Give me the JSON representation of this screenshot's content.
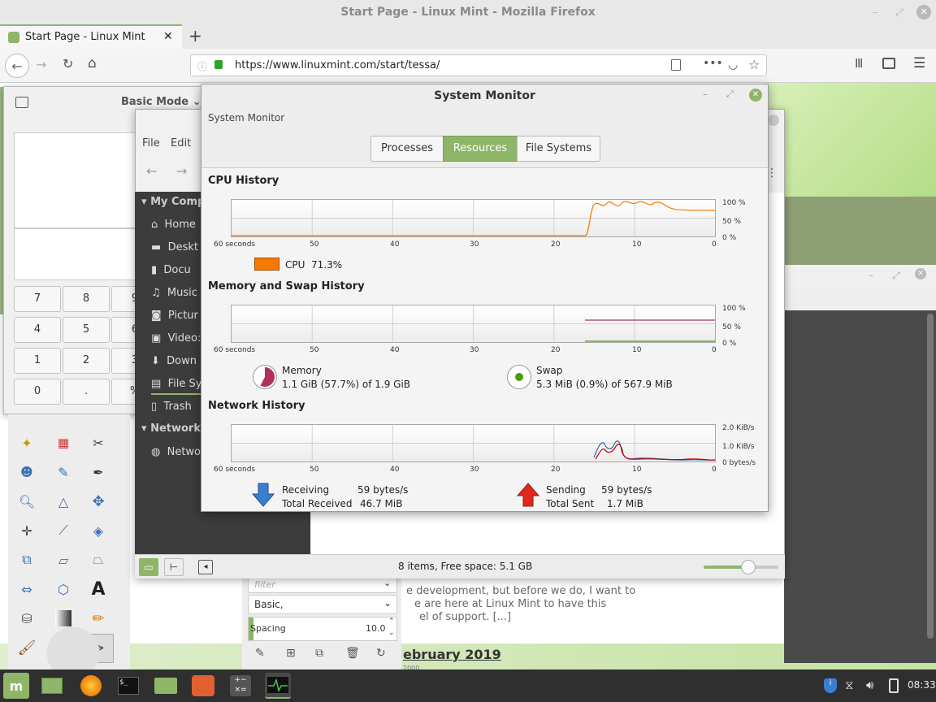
{
  "firefox": {
    "window_title": "Start Page - Linux Mint - Mozilla Firefox",
    "tab_title": "Start Page - Linux Mint",
    "url": "https://www.linuxmint.com/start/tessa/",
    "page_text": {
      "line1": "e development, but before we do, I want to",
      "line2": "e are here at Linux Mint to have this",
      "line3": "el of support. [...]",
      "heading": "ebruary 2019",
      "sub": "2000"
    }
  },
  "calculator": {
    "mode": "Basic Mode",
    "keys": [
      "7",
      "8",
      "9",
      "4",
      "5",
      "6",
      "1",
      "2",
      "3",
      "0",
      ".",
      "%"
    ]
  },
  "file_manager": {
    "menu": [
      "File",
      "Edit"
    ],
    "sections": {
      "my_computer": "My Comp",
      "network": "Network"
    },
    "items": [
      "Home",
      "Deskt",
      "Docu",
      "Music",
      "Pictur",
      "Video:",
      "Down",
      "File Sy",
      "Trash"
    ],
    "network_items": [
      "Netwo"
    ],
    "status": "8 items, Free space: 5.1 GB",
    "zoom": 0.6
  },
  "gimp_dock": {
    "filter_placeholder": "filter",
    "preset": "Basic,",
    "spacing_label": "Spacing",
    "spacing_value": "10.0"
  },
  "system_monitor": {
    "title": "System Monitor",
    "header_label": "System Monitor",
    "tabs": [
      "Processes",
      "Resources",
      "File Systems"
    ],
    "active_tab": "Resources",
    "cpu": {
      "section": "CPU History",
      "legend": "CPU",
      "value": "71.3%",
      "color": "#f57900",
      "y_ticks": [
        "100 %",
        "50 %",
        "0 %"
      ]
    },
    "memory": {
      "section": "Memory and Swap History",
      "mem_label": "Memory",
      "mem_value": "1.1 GiB (57.7%) of 1.9 GiB",
      "mem_color": "#b0305e",
      "swap_label": "Swap",
      "swap_value": "5.3 MiB (0.9%) of 567.9 MiB",
      "swap_color": "#4e9a06",
      "y_ticks": [
        "100 %",
        "50 %",
        "0 %"
      ]
    },
    "network": {
      "section": "Network History",
      "recv_label": "Receiving",
      "recv_rate": "59 bytes/s",
      "recv_total_label": "Total Received",
      "recv_total": "46.7 MiB",
      "send_label": "Sending",
      "send_rate": "59 bytes/s",
      "send_total_label": "Total Sent",
      "send_total": "1.7 MiB",
      "y_ticks": [
        "2.0 KiB/s",
        "1.0 KiB/s",
        "0 bytes/s"
      ]
    },
    "x_ticks": [
      "60 seconds",
      "50",
      "40",
      "30",
      "20",
      "10",
      "0"
    ]
  },
  "taskbar": {
    "clock": "08:33",
    "accent": "#8fb569"
  }
}
